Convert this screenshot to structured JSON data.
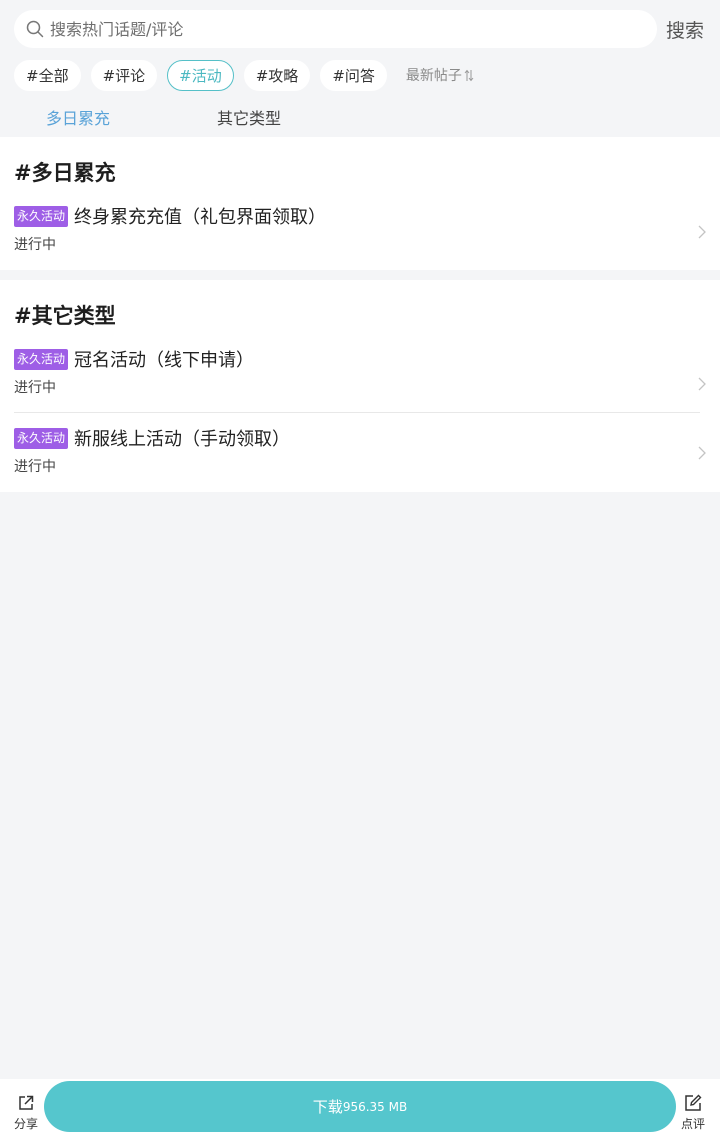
{
  "search": {
    "placeholder": "搜索热门话题/评论",
    "button_label": "搜索"
  },
  "tags": [
    {
      "label": "#全部",
      "active": false
    },
    {
      "label": "#评论",
      "active": false
    },
    {
      "label": "#活动",
      "active": true
    },
    {
      "label": "#攻略",
      "active": false
    },
    {
      "label": "#问答",
      "active": false
    }
  ],
  "sort": {
    "label": "最新帖子"
  },
  "subtabs": [
    {
      "label": "多日累充",
      "active": true
    },
    {
      "label": "其它类型",
      "active": false
    }
  ],
  "sections": [
    {
      "title": "#多日累充",
      "items": [
        {
          "badge": "永久活动",
          "title": "终身累充充值（礼包界面领取）",
          "status": "进行中"
        }
      ]
    },
    {
      "title": "#其它类型",
      "items": [
        {
          "badge": "永久活动",
          "title": "冠名活动（线下申请）",
          "status": "进行中"
        },
        {
          "badge": "永久活动",
          "title": "新服线上活动（手动领取）",
          "status": "进行中"
        }
      ]
    }
  ],
  "bottom_bar": {
    "share_label": "分享",
    "download_label": "下载",
    "download_size": "956.35 MB",
    "review_label": "点评"
  },
  "colors": {
    "accent": "#55c6cd",
    "badge": "#9e5ee6",
    "subtab_active": "#5aa3d8",
    "background": "#f4f5f7"
  }
}
